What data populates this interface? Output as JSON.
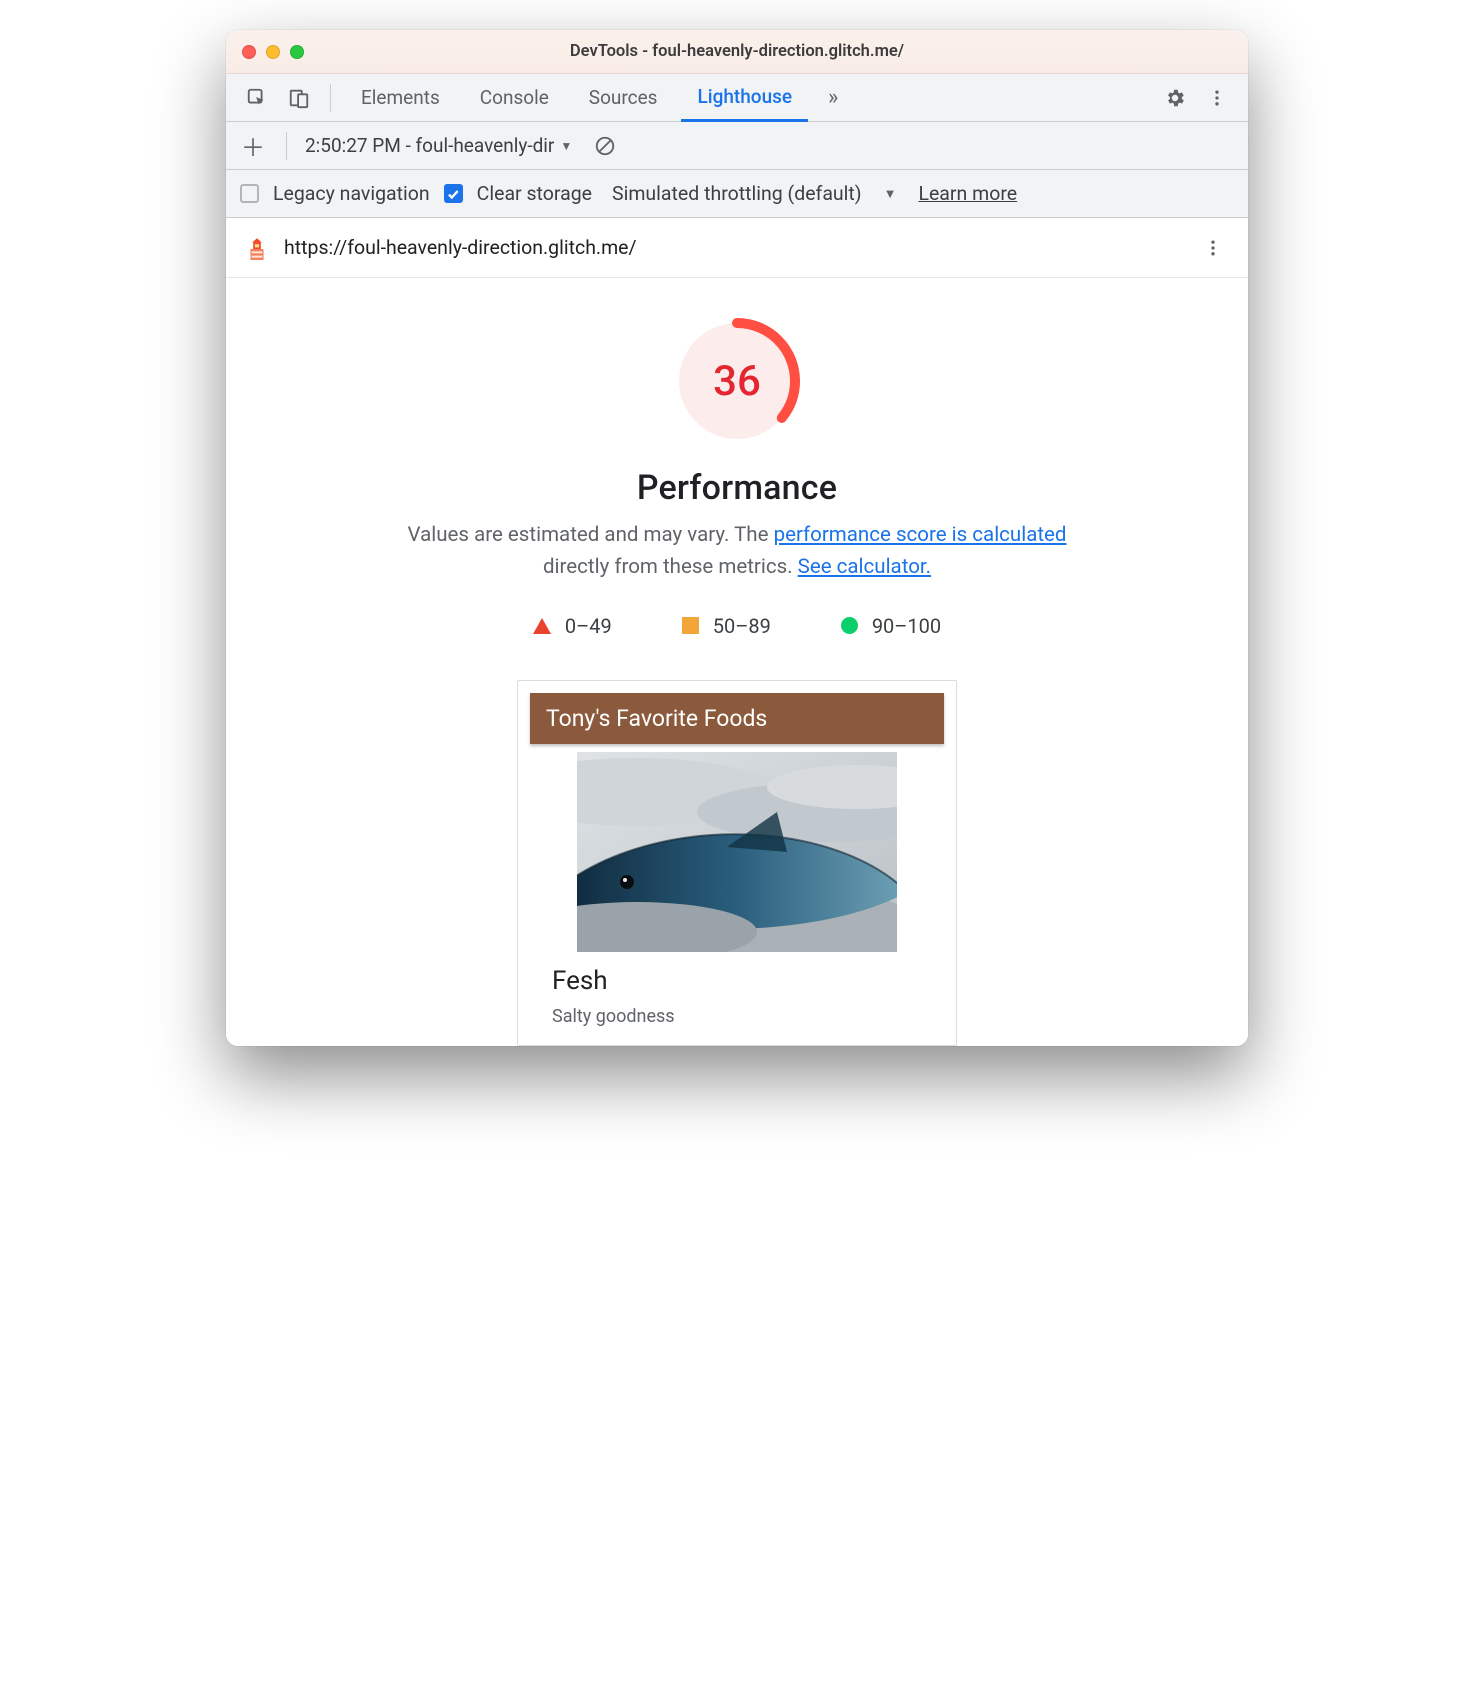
{
  "window": {
    "title": "DevTools - foul-heavenly-direction.glitch.me/"
  },
  "tabs": {
    "items": [
      "Elements",
      "Console",
      "Sources",
      "Lighthouse"
    ],
    "active": "Lighthouse"
  },
  "reportbar": {
    "selected": "2:50:27 PM - foul-heavenly-dir"
  },
  "options": {
    "legacy_label": "Legacy navigation",
    "legacy_checked": false,
    "clear_label": "Clear storage",
    "clear_checked": true,
    "throttling_label": "Simulated throttling (default)",
    "learn_more": "Learn more"
  },
  "url": "https://foul-heavenly-direction.glitch.me/",
  "score": {
    "value": "36",
    "percent": 36,
    "category": "Performance",
    "desc_pre": "Values are estimated and may vary. The ",
    "desc_link1": "performance score is calculated",
    "desc_mid": " directly from these metrics. ",
    "desc_link2": "See calculator."
  },
  "legend": {
    "fail": "0–49",
    "avg": "50–89",
    "pass": "90–100"
  },
  "filmstrip": {
    "header": "Tony's Favorite Foods",
    "item_title": "Fesh",
    "item_sub": "Salty goodness"
  }
}
